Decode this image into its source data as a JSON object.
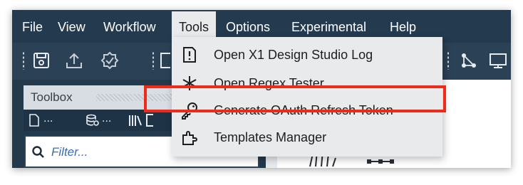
{
  "menubar": {
    "items": [
      {
        "label": "File"
      },
      {
        "label": "View"
      },
      {
        "label": "Workflow"
      },
      {
        "label": "Tools"
      },
      {
        "label": "Options"
      },
      {
        "label": "Experimental"
      },
      {
        "label": "Help"
      }
    ]
  },
  "toolbar": {
    "icons": [
      "save-icon",
      "upload-icon",
      "check-badge-icon",
      "network-icon",
      "monitor-icon"
    ]
  },
  "tools_menu": {
    "items": [
      {
        "label": "Open X1 Design Studio Log",
        "icon": "log-document-icon"
      },
      {
        "label": "Open Regex Tester",
        "icon": "asterisk-icon"
      },
      {
        "label": "Generate OAuth Refresh Token",
        "icon": "key-icon"
      },
      {
        "label": "Templates Manager",
        "icon": "templates-puzzle-icon"
      }
    ]
  },
  "toolbox": {
    "title": "Toolbox",
    "dots": "...",
    "filter_placeholder": "Filter..."
  },
  "colors": {
    "menubar_bg": "#243a4f",
    "dropdown_bg": "#e9eaec",
    "highlight": "#ee2a1b",
    "filter_text": "#3c6cb0"
  }
}
